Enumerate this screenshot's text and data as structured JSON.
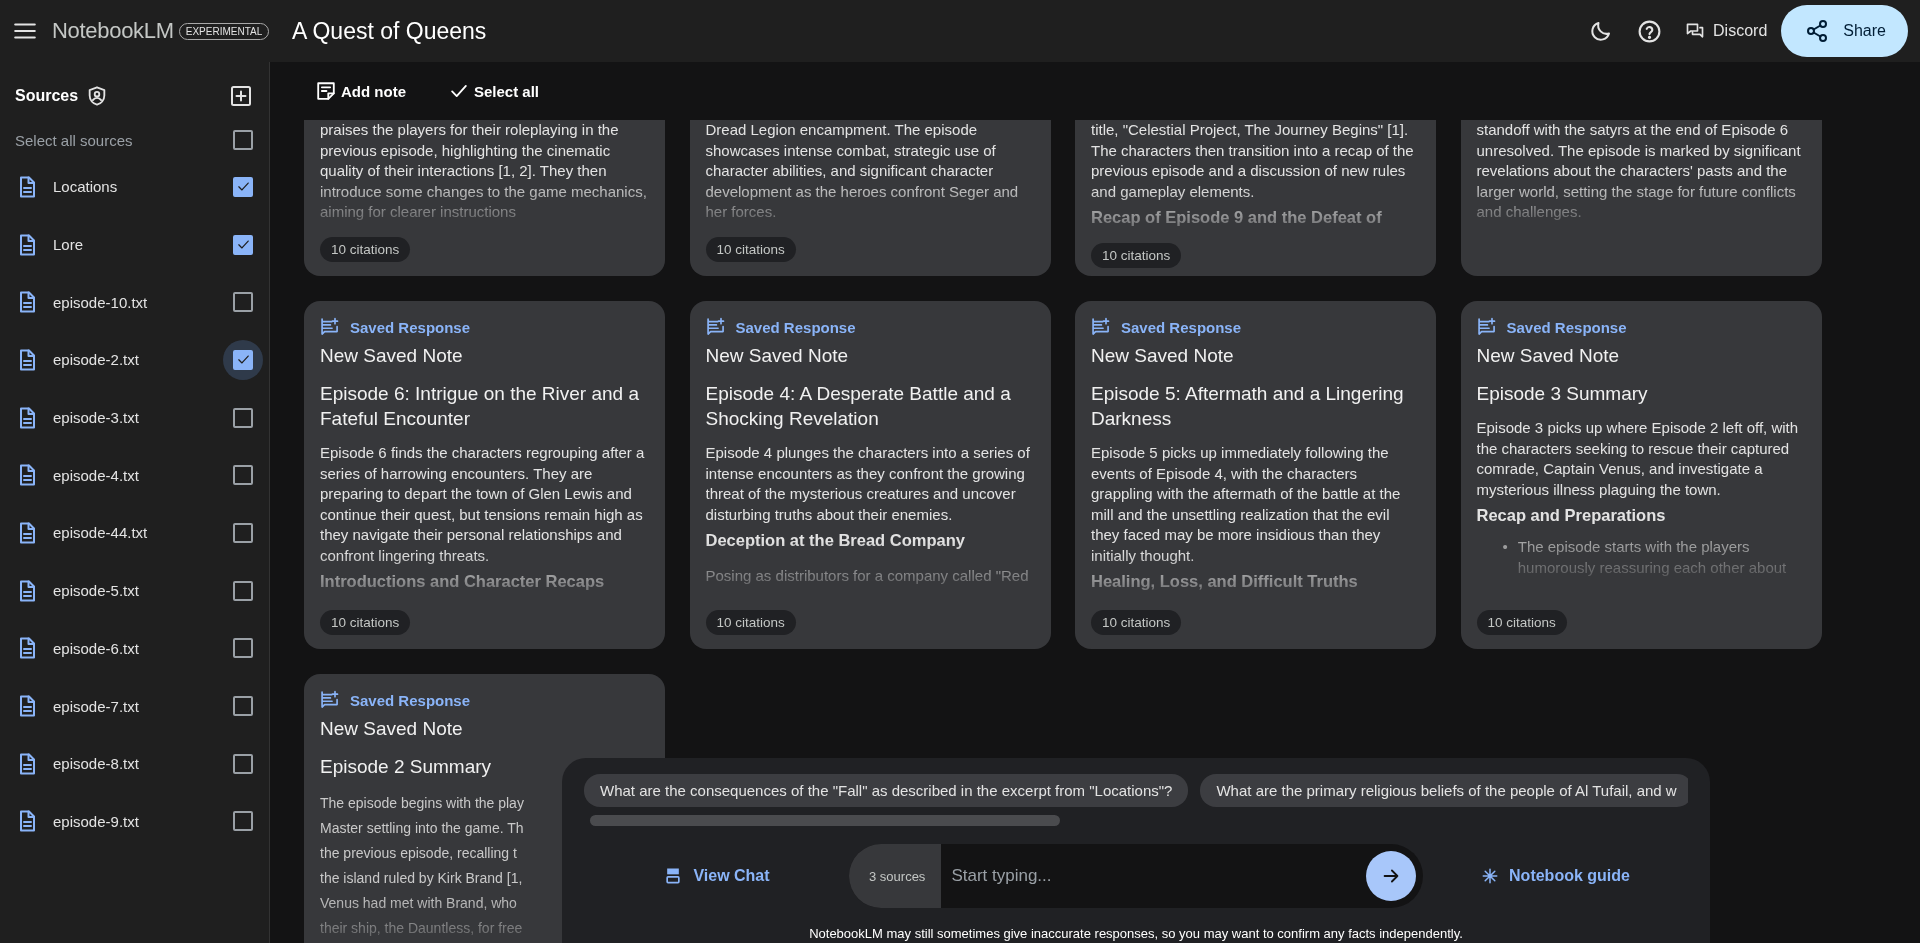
{
  "app": {
    "name": "NotebookLM",
    "badge": "EXPERIMENTAL"
  },
  "notebook": {
    "title": "A Quest of Queens"
  },
  "header_actions": {
    "discord": "Discord",
    "share": "Share"
  },
  "sources": {
    "title": "Sources",
    "select_all": {
      "label": "Select all sources",
      "checked": false
    },
    "items": [
      {
        "name": "Locations",
        "checked": true,
        "hovered": false
      },
      {
        "name": "Lore",
        "checked": true,
        "hovered": false
      },
      {
        "name": "episode-10.txt",
        "checked": false,
        "hovered": false
      },
      {
        "name": "episode-2.txt",
        "checked": true,
        "hovered": true
      },
      {
        "name": "episode-3.txt",
        "checked": false,
        "hovered": false
      },
      {
        "name": "episode-4.txt",
        "checked": false,
        "hovered": false
      },
      {
        "name": "episode-44.txt",
        "checked": false,
        "hovered": false
      },
      {
        "name": "episode-5.txt",
        "checked": false,
        "hovered": false
      },
      {
        "name": "episode-6.txt",
        "checked": false,
        "hovered": false
      },
      {
        "name": "episode-7.txt",
        "checked": false,
        "hovered": false
      },
      {
        "name": "episode-8.txt",
        "checked": false,
        "hovered": false
      },
      {
        "name": "episode-9.txt",
        "checked": false,
        "hovered": false
      }
    ]
  },
  "toolbar": {
    "add_note": "Add note",
    "select_all": "Select all"
  },
  "notes": [
    {
      "kind": "continued",
      "summary": "praises the players for their roleplaying in the previous episode, highlighting the cinematic quality of their interactions [1, 2]. They then introduce some changes to the game mechanics, aiming for clearer instructions",
      "citations": "10 citations"
    },
    {
      "kind": "continued",
      "summary": "Dread Legion encampment. The episode showcases intense combat, strategic use of character abilities, and significant character development as the heroes confront Seger and her forces.",
      "citations": "10 citations"
    },
    {
      "kind": "continued",
      "summary": "title, \"Celestial Project, The Journey Begins\" [1]. The characters then transition into a recap of the previous episode and a discussion of new rules and gameplay elements.",
      "section": "Recap of Episode 9 and the Defeat of",
      "citations": "10 citations"
    },
    {
      "kind": "continued",
      "summary": "standoff with the satyrs at the end of Episode 6 unresolved. The episode is marked by significant revelations about the characters' pasts and the larger world, setting the stage for future conflicts and challenges."
    },
    {
      "kind": "full",
      "label": "Saved Response",
      "title": "New Saved Note",
      "heading": "Episode 6: Intrigue on the River and a Fateful Encounter",
      "summary": "Episode 6 finds the characters regrouping after a series of harrowing encounters. They are preparing to depart the town of Glen Lewis and continue their quest, but tensions remain high as they navigate their personal relationships and confront lingering threats.",
      "section": "Introductions and Character Recaps",
      "citations": "10 citations"
    },
    {
      "kind": "full",
      "label": "Saved Response",
      "title": "New Saved Note",
      "heading": "Episode 4: A Desperate Battle and a Shocking Revelation",
      "summary": "Episode 4 plunges the characters into a series of intense encounters as they confront the growing threat of the mysterious creatures and uncover disturbing truths about their enemies.",
      "section": "Deception at the Bread Company",
      "excerpt": "Posing as distributors for a company called \"Red",
      "citations": "10 citations"
    },
    {
      "kind": "full",
      "label": "Saved Response",
      "title": "New Saved Note",
      "heading": "Episode 5: Aftermath and a Lingering Darkness",
      "summary": "Episode 5 picks up immediately following the events of Episode 4, with the characters grappling with the aftermath of the battle at the mill and the unsettling realization that the evil they faced may be more insidious than they initially thought.",
      "section": "Healing, Loss, and Difficult Truths",
      "citations": "10 citations"
    },
    {
      "kind": "full",
      "label": "Saved Response",
      "title": "New Saved Note",
      "heading": "Episode 3 Summary",
      "summary": "Episode 3 picks up where Episode 2 left off, with the characters seeking to rescue their captured comrade, Captain Venus, and investigate a mysterious illness plaguing the town.",
      "section": "Recap and Preparations",
      "bullet_marker": "•",
      "bullet": "The episode starts with the players humorously reassuring each other about",
      "citations": "10 citations"
    },
    {
      "kind": "clipped",
      "label": "Saved Response",
      "title": "New Saved Note",
      "heading": "Episode 2 Summary",
      "summary": "The episode begins with the play\nMaster settling into the game. Th\nthe previous episode, recalling t\nthe island ruled by Kirk Brand [1,\nVenus had met with Brand, who\ntheir ship, the Dauntless, for free"
    }
  ],
  "chat": {
    "suggestions": [
      "What are the consequences of the \"Fall\" as described in the excerpt from \"Locations\"?",
      "What are the primary religious beliefs of the people of Al Tufail, and w"
    ],
    "view_chat": "View Chat",
    "source_count": "3 sources",
    "input": {
      "placeholder": "Start typing..."
    },
    "notebook_guide": "Notebook guide",
    "disclaimer": "NotebookLM may still sometimes give inaccurate responses, so you may want to confirm any facts independently."
  }
}
